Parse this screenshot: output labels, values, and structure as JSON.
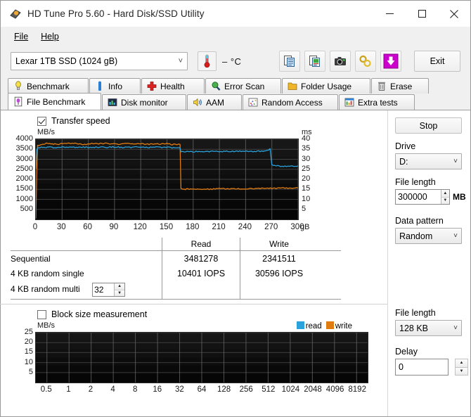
{
  "window": {
    "title": "HD Tune Pro 5.60 - Hard Disk/SSD Utility",
    "icon": "hdtune-logo-icon",
    "minimize": "minimize-button",
    "maximize": "maximize-button",
    "close": "close-button"
  },
  "menu": {
    "items": [
      {
        "label": "File",
        "accel": "F"
      },
      {
        "label": "Help",
        "accel": "H"
      }
    ]
  },
  "toolbar": {
    "drive": "Lexar 1TB SSD (1024 gB)",
    "temperature": "– °C",
    "buttons": [
      {
        "name": "copy-icon",
        "label": ""
      },
      {
        "name": "copy-image-icon",
        "label": ""
      },
      {
        "name": "camera-icon",
        "label": ""
      },
      {
        "name": "options-icon",
        "label": ""
      },
      {
        "name": "download-icon",
        "label": ""
      }
    ],
    "exit_label": "Exit"
  },
  "tabs": {
    "row1": [
      {
        "label": "Benchmark",
        "icon": "benchmark-icon",
        "active": false
      },
      {
        "label": "Info",
        "icon": "info-icon",
        "active": false
      },
      {
        "label": "Health",
        "icon": "health-icon",
        "active": false
      },
      {
        "label": "Error Scan",
        "icon": "error-scan-icon",
        "active": false
      },
      {
        "label": "Folder Usage",
        "icon": "folder-usage-icon",
        "active": false
      },
      {
        "label": "Erase",
        "icon": "erase-icon",
        "active": false
      }
    ],
    "row2": [
      {
        "label": "File Benchmark",
        "icon": "file-benchmark-icon",
        "active": true
      },
      {
        "label": "Disk monitor",
        "icon": "disk-monitor-icon",
        "active": false
      },
      {
        "label": "AAM",
        "icon": "aam-icon",
        "active": false
      },
      {
        "label": "Random Access",
        "icon": "random-access-icon",
        "active": false
      },
      {
        "label": "Extra tests",
        "icon": "extra-tests-icon",
        "active": false
      }
    ]
  },
  "transfer_panel": {
    "checkbox_label": "Transfer speed",
    "checked": true
  },
  "results": {
    "col_headers": [
      "",
      "Read",
      "Write"
    ],
    "rows": [
      {
        "name": "Sequential",
        "read": "3481278",
        "write": "2341511"
      },
      {
        "name": "4 KB random single",
        "read": "10401 IOPS",
        "write": "30596 IOPS"
      },
      {
        "name": "4 KB random multi",
        "read": "",
        "write": "",
        "queue_depth": "32"
      }
    ]
  },
  "controls_top": {
    "stop_label": "Stop",
    "drive_label": "Drive",
    "drive_value": "D:",
    "file_length_label": "File length",
    "file_length_value": "300000",
    "file_length_unit": "MB",
    "data_pattern_label": "Data pattern",
    "data_pattern_value": "Random"
  },
  "block_panel": {
    "checkbox_label": "Block size measurement",
    "checked": false,
    "legend": [
      {
        "label": "read",
        "color": "#2aa3dd"
      },
      {
        "label": "write",
        "color": "#e07b10"
      }
    ]
  },
  "controls_bottom": {
    "file_length_label": "File length",
    "file_length_value": "128 KB",
    "delay_label": "Delay",
    "delay_value": "0"
  },
  "colors": {
    "read": "#2aa3dd",
    "write": "#e07b10",
    "plot_bg": "#000000",
    "grid": "#6a6a6a",
    "tick_text": "#1a1a1a",
    "accent_magenta": "#cc00cc"
  },
  "chart_data": [
    {
      "type": "line",
      "title": "Transfer speed",
      "ylabel": "MB/s",
      "y2label": "ms",
      "xlabel": "gB",
      "xlim": [
        0,
        300
      ],
      "ylim": [
        0,
        4000
      ],
      "y2lim": [
        0,
        40
      ],
      "xticks": [
        0,
        30,
        60,
        90,
        120,
        150,
        180,
        210,
        240,
        270,
        300
      ],
      "yticks": [
        500,
        1000,
        1500,
        2000,
        2500,
        3000,
        3500,
        4000
      ],
      "y2ticks": [
        5,
        10,
        15,
        20,
        25,
        30,
        35,
        40
      ],
      "grid": true,
      "legend": [
        "read",
        "write"
      ],
      "series": [
        {
          "name": "write",
          "color": "#e07b10",
          "axis": "left",
          "x": [
            0,
            1,
            2,
            4,
            8,
            12,
            16,
            20,
            26,
            32,
            40,
            48,
            56,
            64,
            72,
            80,
            88,
            96,
            104,
            112,
            120,
            128,
            136,
            144,
            150,
            156,
            162,
            165,
            166,
            168,
            174,
            180,
            190,
            200,
            210,
            220,
            230,
            240,
            250,
            260,
            270,
            280,
            290,
            300
          ],
          "values": [
            60,
            2250,
            3720,
            3690,
            3740,
            3790,
            3800,
            3750,
            3760,
            3790,
            3800,
            3770,
            3740,
            3800,
            3780,
            3800,
            3770,
            3760,
            3790,
            3760,
            3780,
            3750,
            3780,
            3760,
            3790,
            3740,
            3760,
            3740,
            1560,
            1500,
            1510,
            1490,
            1500,
            1510,
            1530,
            1520,
            1530,
            1530,
            1540,
            1550,
            1550,
            1560,
            1560,
            1570
          ]
        },
        {
          "name": "read",
          "color": "#2aa3dd",
          "axis": "right",
          "x": [
            0,
            1,
            2,
            4,
            8,
            12,
            16,
            20,
            26,
            32,
            40,
            48,
            56,
            64,
            72,
            80,
            88,
            96,
            104,
            112,
            120,
            128,
            136,
            144,
            150,
            156,
            162,
            165,
            166,
            168,
            174,
            180,
            190,
            200,
            210,
            220,
            230,
            240,
            250,
            260,
            266,
            268,
            270,
            280,
            290,
            300
          ],
          "values": [
            25.5,
            34.5,
            36.0,
            35.9,
            36.1,
            36.0,
            36.2,
            35.9,
            36.0,
            36.1,
            36.0,
            35.8,
            36.0,
            36.1,
            36.0,
            35.9,
            36.1,
            36.0,
            35.9,
            36.0,
            36.1,
            35.8,
            36.0,
            35.9,
            36.1,
            35.8,
            36.0,
            36.0,
            34.0,
            33.7,
            33.9,
            33.8,
            34.0,
            33.9,
            34.0,
            33.9,
            34.0,
            33.9,
            34.0,
            34.0,
            34.6,
            35.3,
            27.0,
            26.6,
            26.5,
            26.7
          ]
        }
      ]
    },
    {
      "type": "line",
      "title": "Block size measurement",
      "ylabel": "MB/s",
      "xlabel": "",
      "xticks": [
        "0.5",
        "1",
        "2",
        "4",
        "8",
        "16",
        "32",
        "64",
        "128",
        "256",
        "512",
        "1024",
        "2048",
        "4096",
        "8192"
      ],
      "yticks": [
        5,
        10,
        15,
        20,
        25
      ],
      "ylim": [
        0,
        25
      ],
      "grid": true,
      "legend": [
        "read",
        "write"
      ],
      "series": [
        {
          "name": "read",
          "color": "#2aa3dd",
          "values": []
        },
        {
          "name": "write",
          "color": "#e07b10",
          "values": []
        }
      ]
    }
  ]
}
